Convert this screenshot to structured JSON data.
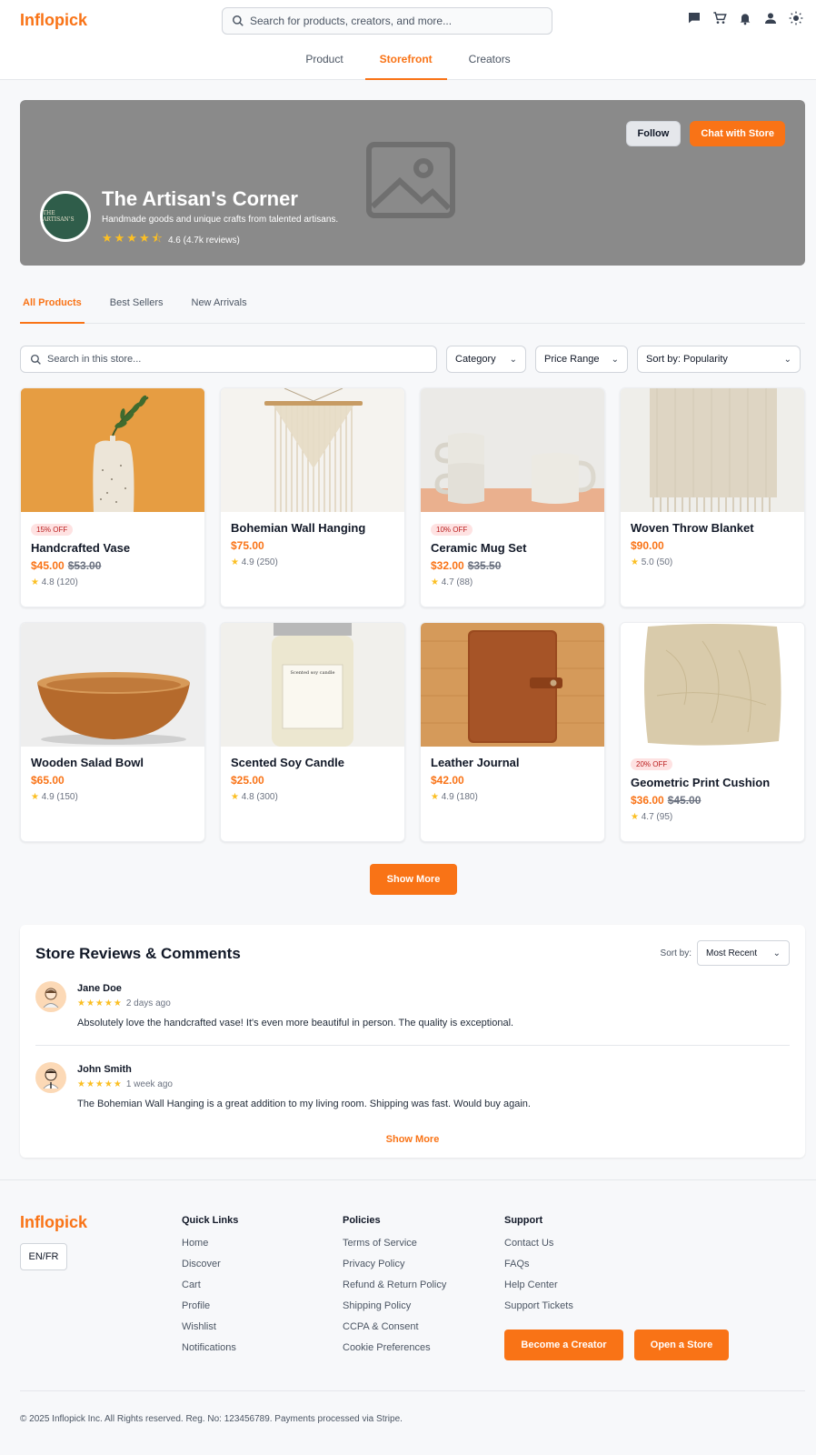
{
  "header": {
    "logo": "Inflopick",
    "search_placeholder": "Search for products, creators, and more...",
    "nav_tabs": [
      "Product",
      "Storefront",
      "Creators"
    ],
    "active_tab": "Storefront",
    "icons": [
      "chat-icon",
      "cart-icon",
      "bell-icon",
      "user-icon",
      "sun-icon"
    ]
  },
  "store": {
    "name": "The Artisan's Corner",
    "tagline": "Handmade goods and unique crafts from talented artisans.",
    "rating_text": "4.6 (4.7k reviews)",
    "rating": 4.6,
    "follow_label": "Follow",
    "chat_label": "Chat with Store",
    "avatar_text": "THE ARTISAN'S"
  },
  "store_tabs": [
    "All Products",
    "Best Sellers",
    "New Arrivals"
  ],
  "filters": {
    "search_placeholder": "Search in this store...",
    "category": "Category",
    "price_range": "Price Range",
    "sort": "Sort by: Popularity"
  },
  "products": [
    {
      "name": "Handcrafted Vase",
      "badge": "15% OFF",
      "price": "$45.00",
      "old_price": "$53.00",
      "rating": "4.8 (120)"
    },
    {
      "name": "Bohemian Wall Hanging",
      "badge": "",
      "price": "$75.00",
      "old_price": "",
      "rating": "4.9 (250)"
    },
    {
      "name": "Ceramic Mug Set",
      "badge": "10% OFF",
      "price": "$32.00",
      "old_price": "$35.50",
      "rating": "4.7 (88)"
    },
    {
      "name": "Woven Throw Blanket",
      "badge": "",
      "price": "$90.00",
      "old_price": "",
      "rating": "5.0 (50)"
    },
    {
      "name": "Wooden Salad Bowl",
      "badge": "",
      "price": "$65.00",
      "old_price": "",
      "rating": "4.9 (150)"
    },
    {
      "name": "Scented Soy Candle",
      "badge": "",
      "price": "$25.00",
      "old_price": "",
      "rating": "4.8 (300)"
    },
    {
      "name": "Leather Journal",
      "badge": "",
      "price": "$42.00",
      "old_price": "",
      "rating": "4.9 (180)"
    },
    {
      "name": "Geometric Print Cushion",
      "badge": "20% OFF",
      "price": "$36.00",
      "old_price": "$45.00",
      "rating": "4.7 (95)"
    }
  ],
  "candle_label": "Scented soy candle",
  "show_more_label": "Show More",
  "reviews": {
    "title": "Store Reviews & Comments",
    "sort_label": "Sort by:",
    "sort_value": "Most Recent",
    "items": [
      {
        "name": "Jane Doe",
        "stars": "★★★★★",
        "time": "2 days ago",
        "text": "Absolutely love the handcrafted vase! It's even more beautiful in person. The quality is exceptional."
      },
      {
        "name": "John Smith",
        "stars": "★★★★★",
        "time": "1 week ago",
        "text": "The Bohemian Wall Hanging is a great addition to my living room. Shipping was fast. Would buy again."
      }
    ],
    "show_more_label": "Show More"
  },
  "footer": {
    "logo": "Inflopick",
    "lang": "EN/FR",
    "quick_links_title": "Quick Links",
    "quick_links": [
      "Home",
      "Discover",
      "Cart",
      "Profile",
      "Wishlist",
      "Notifications"
    ],
    "policies_title": "Policies",
    "policies": [
      "Terms of Service",
      "Privacy Policy",
      "Refund & Return Policy",
      "Shipping Policy",
      "CCPA & Consent",
      "Cookie Preferences"
    ],
    "support_title": "Support",
    "support": [
      "Contact Us",
      "FAQs",
      "Help Center",
      "Support Tickets"
    ],
    "become_creator": "Become a Creator",
    "open_store": "Open a Store",
    "copyright": "© 2025 Inflopick Inc. All Rights reserved. Reg. No: 123456789. Payments processed via Stripe."
  },
  "colors": {
    "accent": "#f97316",
    "banner": "#8a8a8a",
    "star": "#fbbf24"
  }
}
